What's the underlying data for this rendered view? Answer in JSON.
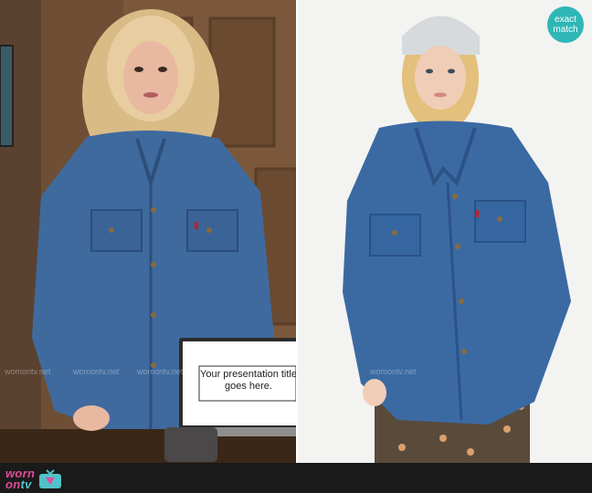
{
  "badge": {
    "line1": "exact",
    "line2": "match"
  },
  "laptop_slide": {
    "line1": "Your presentation title",
    "line2": "goes here."
  },
  "watermark": {
    "text": "womontv.net"
  },
  "footer": {
    "brand_worn": "worn",
    "brand_on": "on",
    "brand_tv": "tv"
  },
  "colors": {
    "denim": "#3f6a9e",
    "badge_bg": "#2fb7b5",
    "brand_pink": "#e44b9b",
    "brand_teal": "#4fc3c8"
  }
}
